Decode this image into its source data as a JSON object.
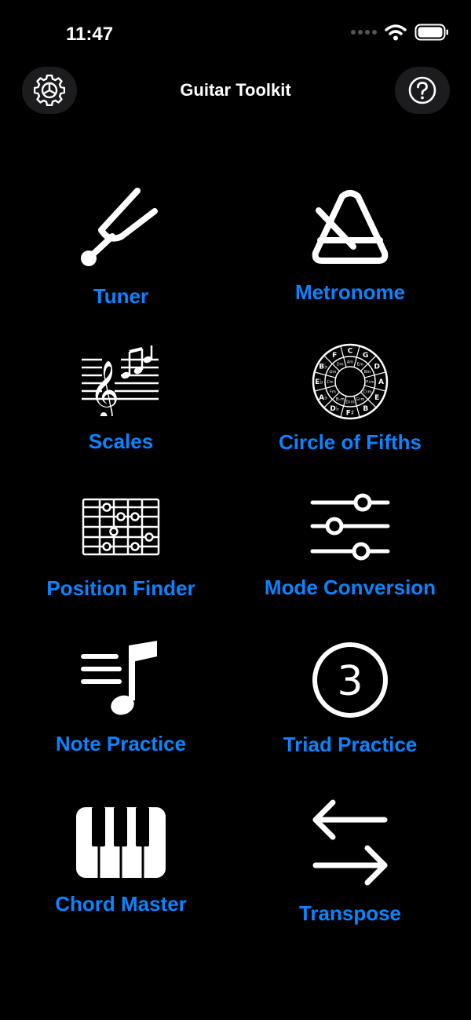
{
  "status_bar": {
    "time": "11:47",
    "icons": [
      "cellular-dots-icon",
      "wifi-icon",
      "battery-icon"
    ]
  },
  "nav": {
    "title": "Guitar Toolkit",
    "left_icon": "gear-icon",
    "right_icon": "help-icon"
  },
  "colors": {
    "background": "#000000",
    "accent": "#0a84ff",
    "icon": "#ffffff",
    "button_bg": "#1c1c1e"
  },
  "tools": [
    {
      "label": "Tuner",
      "icon": "tuning-fork-icon"
    },
    {
      "label": "Metronome",
      "icon": "metronome-icon"
    },
    {
      "label": "Scales",
      "icon": "music-staff-icon"
    },
    {
      "label": "Circle of Fifths",
      "icon": "circle-of-fifths-icon"
    },
    {
      "label": "Position Finder",
      "icon": "fretboard-icon"
    },
    {
      "label": "Mode Conversion",
      "icon": "sliders-icon"
    },
    {
      "label": "Note Practice",
      "icon": "music-note-list-icon"
    },
    {
      "label": "Triad Practice",
      "icon": "number-3-circle-icon"
    },
    {
      "label": "Chord Master",
      "icon": "piano-keys-icon"
    },
    {
      "label": "Transpose",
      "icon": "arrows-left-right-icon"
    }
  ],
  "circle_of_fifths": {
    "outer_keys": [
      "C",
      "G",
      "D",
      "A",
      "E",
      "B",
      "F♯",
      "D♭",
      "A♭",
      "E♭",
      "B♭",
      "F"
    ],
    "inner_keys": [
      "Am",
      "Em",
      "Bm",
      "F♯m",
      "C♯m",
      "G♯m",
      "D♯m",
      "B♭m",
      "Fm",
      "Cm",
      "Gm",
      "Dm"
    ]
  },
  "triad_number": "3"
}
